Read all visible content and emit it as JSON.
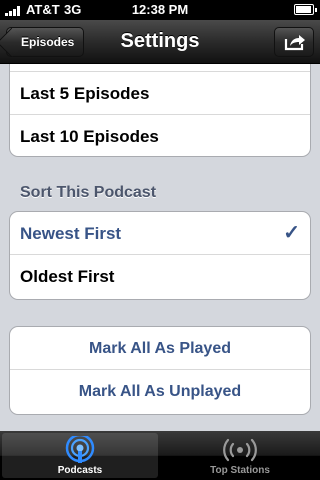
{
  "status_bar": {
    "carrier": "AT&T",
    "network": "3G",
    "time": "12:38 PM"
  },
  "nav": {
    "back_label": "Episodes",
    "title": "Settings"
  },
  "episodes_group": {
    "items": [
      "Last 5 Episodes",
      "Last 10 Episodes"
    ]
  },
  "sort": {
    "header": "Sort This Podcast",
    "options": [
      {
        "label": "Newest First",
        "selected": true
      },
      {
        "label": "Oldest First",
        "selected": false
      }
    ],
    "check_glyph": "✓"
  },
  "actions": {
    "mark_played": "Mark All As Played",
    "mark_unplayed": "Mark All As Unplayed"
  },
  "tabbar": {
    "tabs": [
      {
        "label": "Podcasts",
        "icon": "podcast-icon",
        "active": true
      },
      {
        "label": "Top Stations",
        "icon": "broadcast-icon",
        "active": false
      }
    ]
  },
  "colors": {
    "accent": "#385487",
    "background": "#d4d7dd",
    "tab_active_icon": "#2f8bff"
  }
}
